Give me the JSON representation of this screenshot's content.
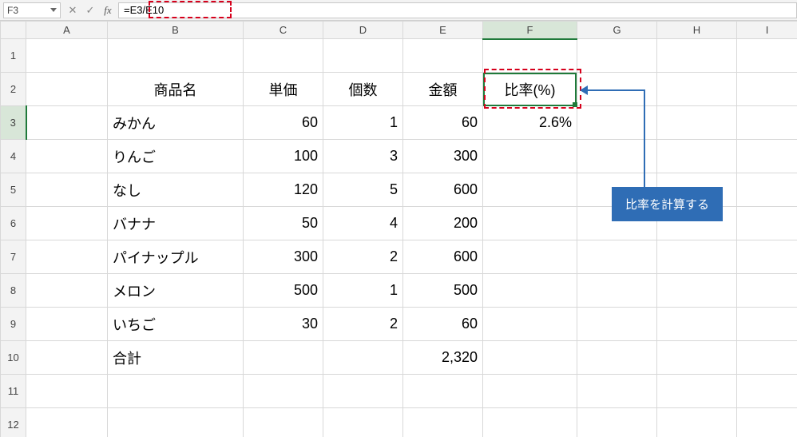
{
  "namebox": "F3",
  "formula": "=E3/E10",
  "columns": [
    "A",
    "B",
    "C",
    "D",
    "E",
    "F",
    "G",
    "H",
    "I"
  ],
  "selected_col": "F",
  "selected_row": 3,
  "row_numbers": [
    1,
    2,
    3,
    4,
    5,
    6,
    7,
    8,
    9,
    10,
    11,
    12
  ],
  "headers": {
    "b": "商品名",
    "c": "単価",
    "d": "個数",
    "e": "金額",
    "f": "比率(%)"
  },
  "rows": [
    {
      "b": "みかん",
      "c": "60",
      "d": "1",
      "e": "60",
      "f": "2.6%"
    },
    {
      "b": "りんご",
      "c": "100",
      "d": "3",
      "e": "300",
      "f": ""
    },
    {
      "b": "なし",
      "c": "120",
      "d": "5",
      "e": "600",
      "f": ""
    },
    {
      "b": "バナナ",
      "c": "50",
      "d": "4",
      "e": "200",
      "f": ""
    },
    {
      "b": "パイナップル",
      "c": "300",
      "d": "2",
      "e": "600",
      "f": ""
    },
    {
      "b": "メロン",
      "c": "500",
      "d": "1",
      "e": "500",
      "f": ""
    },
    {
      "b": "いちご",
      "c": "30",
      "d": "2",
      "e": "60",
      "f": ""
    }
  ],
  "footer": {
    "b": "合計",
    "e": "2,320"
  },
  "callout": "比率を計算する",
  "chart_data": {
    "type": "table",
    "title": "",
    "columns": [
      "商品名",
      "単価",
      "個数",
      "金額",
      "比率(%)"
    ],
    "rows": [
      [
        "みかん",
        60,
        1,
        60,
        "2.6%"
      ],
      [
        "りんご",
        100,
        3,
        300,
        null
      ],
      [
        "なし",
        120,
        5,
        600,
        null
      ],
      [
        "バナナ",
        50,
        4,
        200,
        null
      ],
      [
        "パイナップル",
        300,
        2,
        600,
        null
      ],
      [
        "メロン",
        500,
        1,
        500,
        null
      ],
      [
        "いちご",
        30,
        2,
        60,
        null
      ],
      [
        "合計",
        null,
        null,
        2320,
        null
      ]
    ]
  }
}
